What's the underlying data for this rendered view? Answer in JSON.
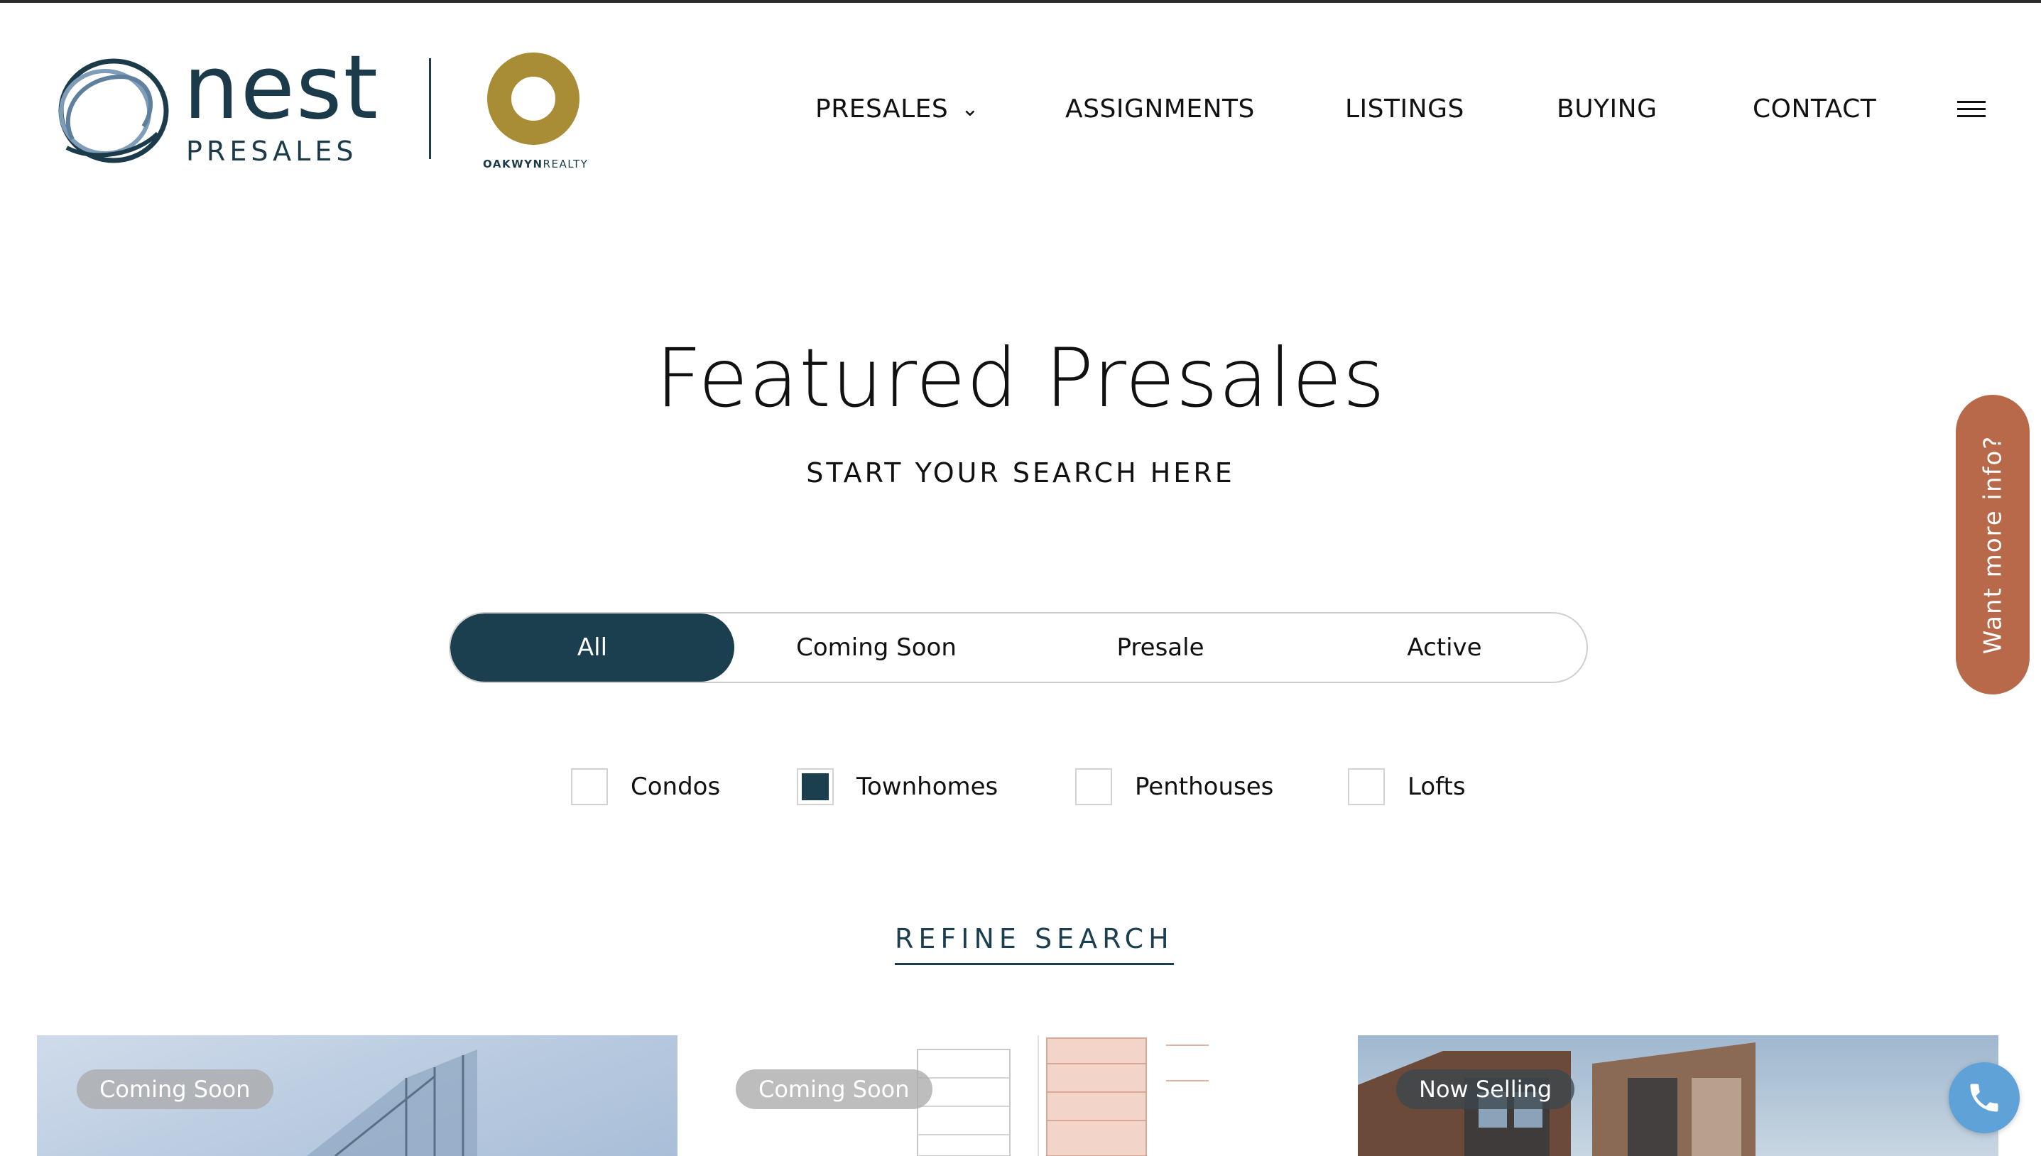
{
  "header": {
    "logo": {
      "brand": "nest",
      "sub": "PRESALES",
      "partner_bold": "OAKWYN",
      "partner_rest": "REALTY"
    },
    "nav": {
      "presales": "PRESALES",
      "assignments": "ASSIGNMENTS",
      "listings": "LISTINGS",
      "buying": "BUYING",
      "contact": "CONTACT"
    },
    "menu_icon": "hamburger-icon"
  },
  "hero": {
    "title": "Featured Presales",
    "subtitle": "START YOUR SEARCH HERE"
  },
  "status_filter": {
    "options": [
      "All",
      "Coming Soon",
      "Presale",
      "Active"
    ],
    "selected": "All"
  },
  "type_filter": {
    "items": [
      {
        "label": "Condos",
        "checked": false
      },
      {
        "label": "Townhomes",
        "checked": true
      },
      {
        "label": "Penthouses",
        "checked": false
      },
      {
        "label": "Lofts",
        "checked": false
      }
    ]
  },
  "refine": "REFINE SEARCH",
  "cards": [
    {
      "badge": "Coming Soon"
    },
    {
      "badge": "Coming Soon"
    },
    {
      "badge": "Now Selling"
    }
  ],
  "side_tab": "Want more info?",
  "colors": {
    "primary": "#1c3f50",
    "gold": "#a88d36",
    "side_tab": "#b8694a",
    "phone": "#5fa2d8"
  },
  "icons": {
    "phone": "phone-icon",
    "chevron": "chevron-down-icon"
  }
}
